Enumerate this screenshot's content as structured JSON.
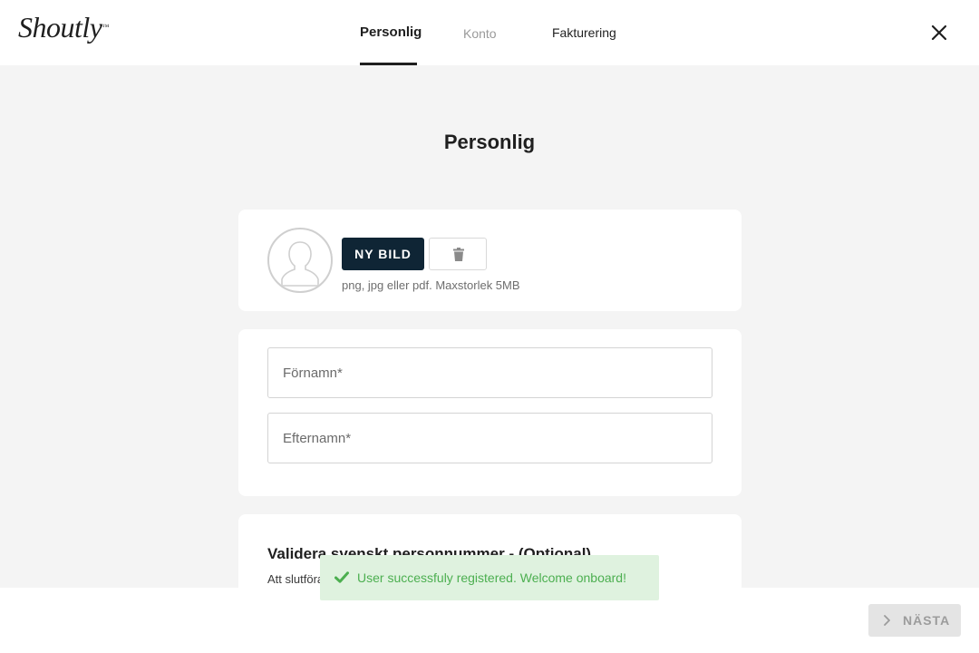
{
  "header": {
    "logo_text": "Shoutly",
    "logo_mark": "™",
    "tabs": [
      {
        "label": "Personlig",
        "state": "active"
      },
      {
        "label": "Konto",
        "state": "disabled"
      },
      {
        "label": "Fakturering",
        "state": "normal"
      }
    ],
    "close_icon": "close-icon"
  },
  "page": {
    "title": "Personlig"
  },
  "photo": {
    "avatar_icon": "user-silhouette-icon",
    "new_picture_label": "NY BILD",
    "delete_icon": "trash-icon",
    "hint": "png, jpg eller pdf. Maxstorlek 5MB"
  },
  "name_form": {
    "first_name_placeholder": "Förnamn*",
    "last_name_placeholder": "Efternamn*"
  },
  "validation": {
    "title": "Validera svenskt personnummer - (Optional)",
    "subtitle": "Att slutföra"
  },
  "toast": {
    "icon": "check-icon",
    "message": "User successfuly registered. Welcome onboard!",
    "color": "#4caf50",
    "background": "#dff2df"
  },
  "footer": {
    "next_label": "NÄSTA",
    "next_icon": "chevron-right-icon"
  },
  "colors": {
    "primary": "#0f2535",
    "page_background": "#f4f4f4"
  }
}
